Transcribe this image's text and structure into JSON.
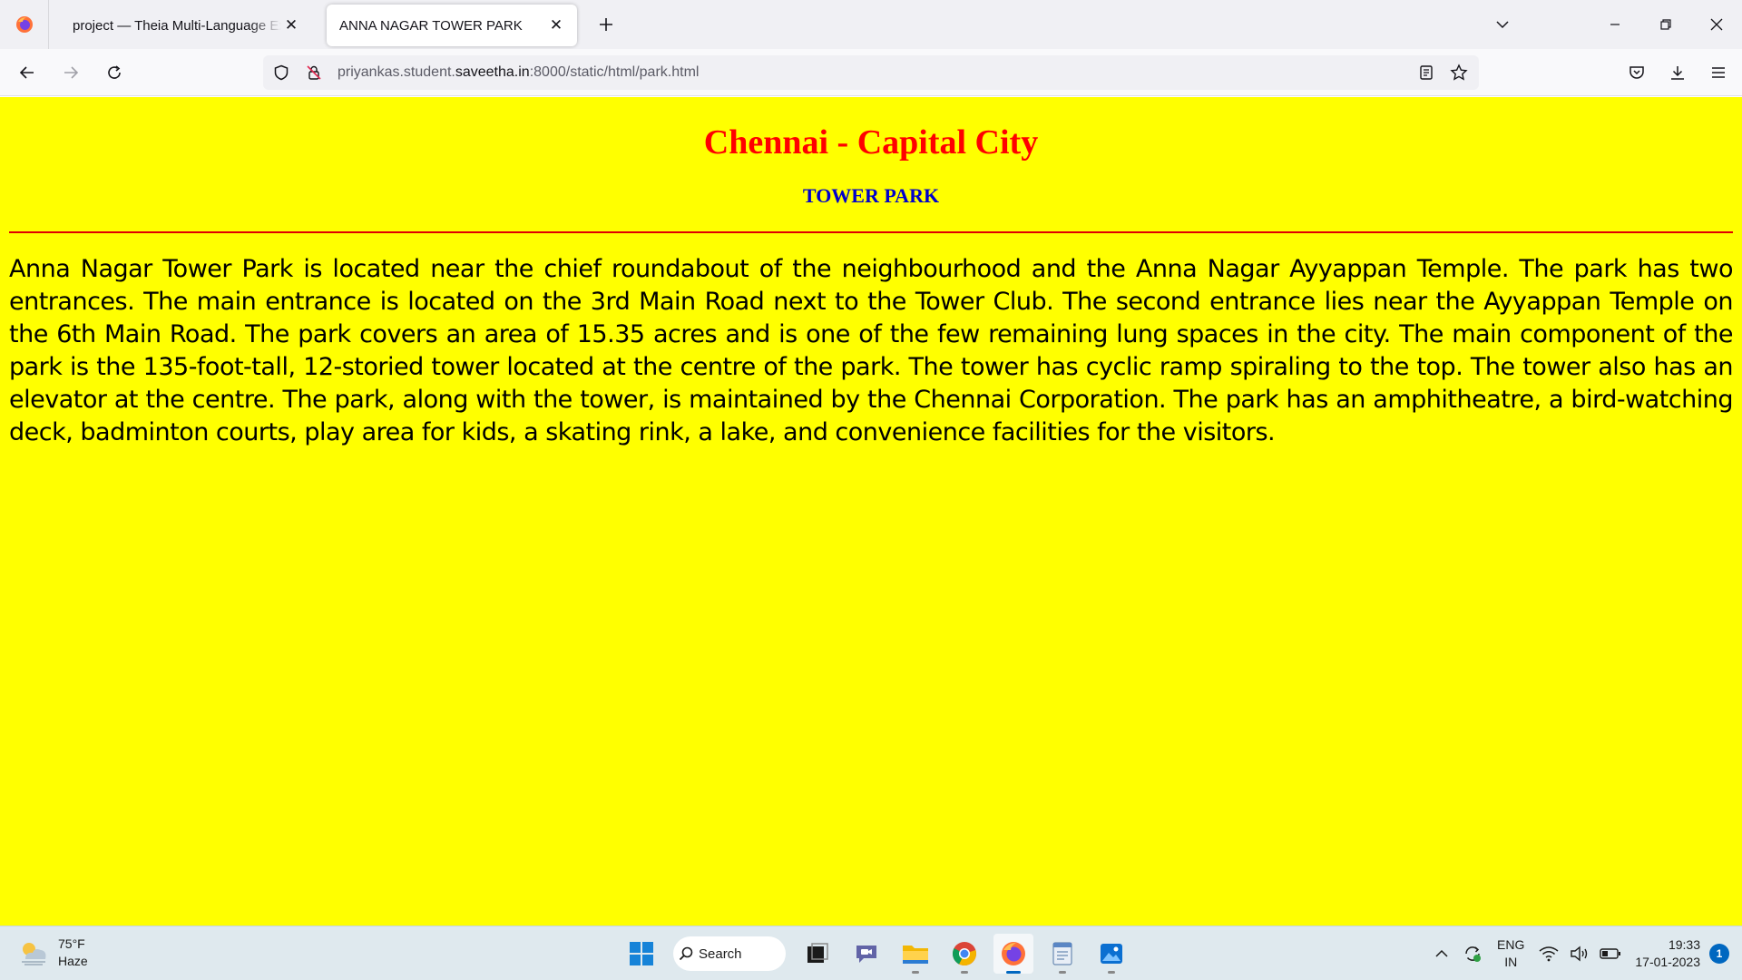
{
  "browser": {
    "tabs": [
      {
        "title": "project — Theia Multi-Language Ex",
        "active": false
      },
      {
        "title": "ANNA NAGAR TOWER PARK",
        "active": true
      }
    ],
    "url": {
      "prefix": "priyankas.student.",
      "host": "saveetha.in",
      "suffix": ":8000/static/html/park.html"
    }
  },
  "page": {
    "background": "#ffff00",
    "title": "Chennai - Capital City",
    "title_color": "#ff0000",
    "subtitle": "TOWER PARK",
    "subtitle_color": "#0000cc",
    "body": "Anna Nagar Tower Park is located near the chief roundabout of the neighbourhood and the Anna Nagar Ayyappan Temple. The park has two entrances. The main entrance is located on the 3rd Main Road next to the Tower Club. The second entrance lies near the Ayyappan Temple on the 6th Main Road. The park covers an area of 15.35 acres and is one of the few remaining lung spaces in the city. The main component of the park is the 135-foot-tall, 12-storied tower located at the centre of the park. The tower has cyclic ramp spiraling to the top. The tower also has an elevator at the centre. The park, along with the tower, is maintained by the Chennai Corporation. The park has an amphitheatre, a bird-watching deck, badminton courts, play area for kids, a skating rink, a lake, and convenience facilities for the visitors."
  },
  "taskbar": {
    "weather": {
      "temp": "75°F",
      "condition": "Haze"
    },
    "search_label": "Search",
    "lang": {
      "line1": "ENG",
      "line2": "IN"
    },
    "clock": {
      "time": "19:33",
      "date": "17-01-2023"
    },
    "notification_count": "1"
  }
}
